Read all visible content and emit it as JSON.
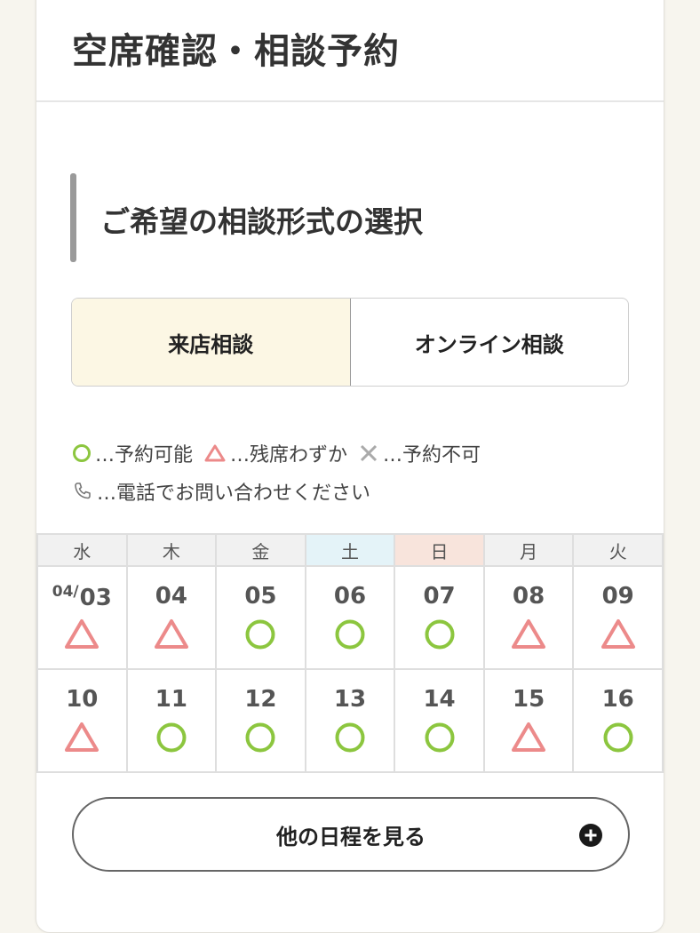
{
  "page": {
    "title": "空席確認・相談予約"
  },
  "section": {
    "title": "ご希望の相談形式の選択"
  },
  "format_toggle": {
    "options": [
      {
        "label": "来店相談",
        "selected": true
      },
      {
        "label": "オンライン相談",
        "selected": false
      }
    ]
  },
  "legend": {
    "available": "…予約可能",
    "few_left": "…残席わずか",
    "unavailable": "…予約不可",
    "phone": "…電話でお問い合わせください"
  },
  "colors": {
    "available": "#8cc63f",
    "few_left": "#ec8a8a",
    "unavailable": "#aaaaaa",
    "selected_bg": "#fcf7e4",
    "saturday_bg": "#e4f3f8",
    "sunday_bg": "#f8e4dc"
  },
  "calendar": {
    "weekdays": [
      "水",
      "木",
      "金",
      "土",
      "日",
      "月",
      "火"
    ],
    "month_prefix": "04/",
    "weeks": [
      [
        {
          "day": "03",
          "status": "few"
        },
        {
          "day": "04",
          "status": "few"
        },
        {
          "day": "05",
          "status": "available"
        },
        {
          "day": "06",
          "status": "available"
        },
        {
          "day": "07",
          "status": "available"
        },
        {
          "day": "08",
          "status": "few"
        },
        {
          "day": "09",
          "status": "few"
        }
      ],
      [
        {
          "day": "10",
          "status": "few"
        },
        {
          "day": "11",
          "status": "available"
        },
        {
          "day": "12",
          "status": "available"
        },
        {
          "day": "13",
          "status": "available"
        },
        {
          "day": "14",
          "status": "available"
        },
        {
          "day": "15",
          "status": "few"
        },
        {
          "day": "16",
          "status": "available"
        }
      ]
    ]
  },
  "more_button": {
    "label": "他の日程を見る",
    "icon": "plus-circle-icon"
  }
}
